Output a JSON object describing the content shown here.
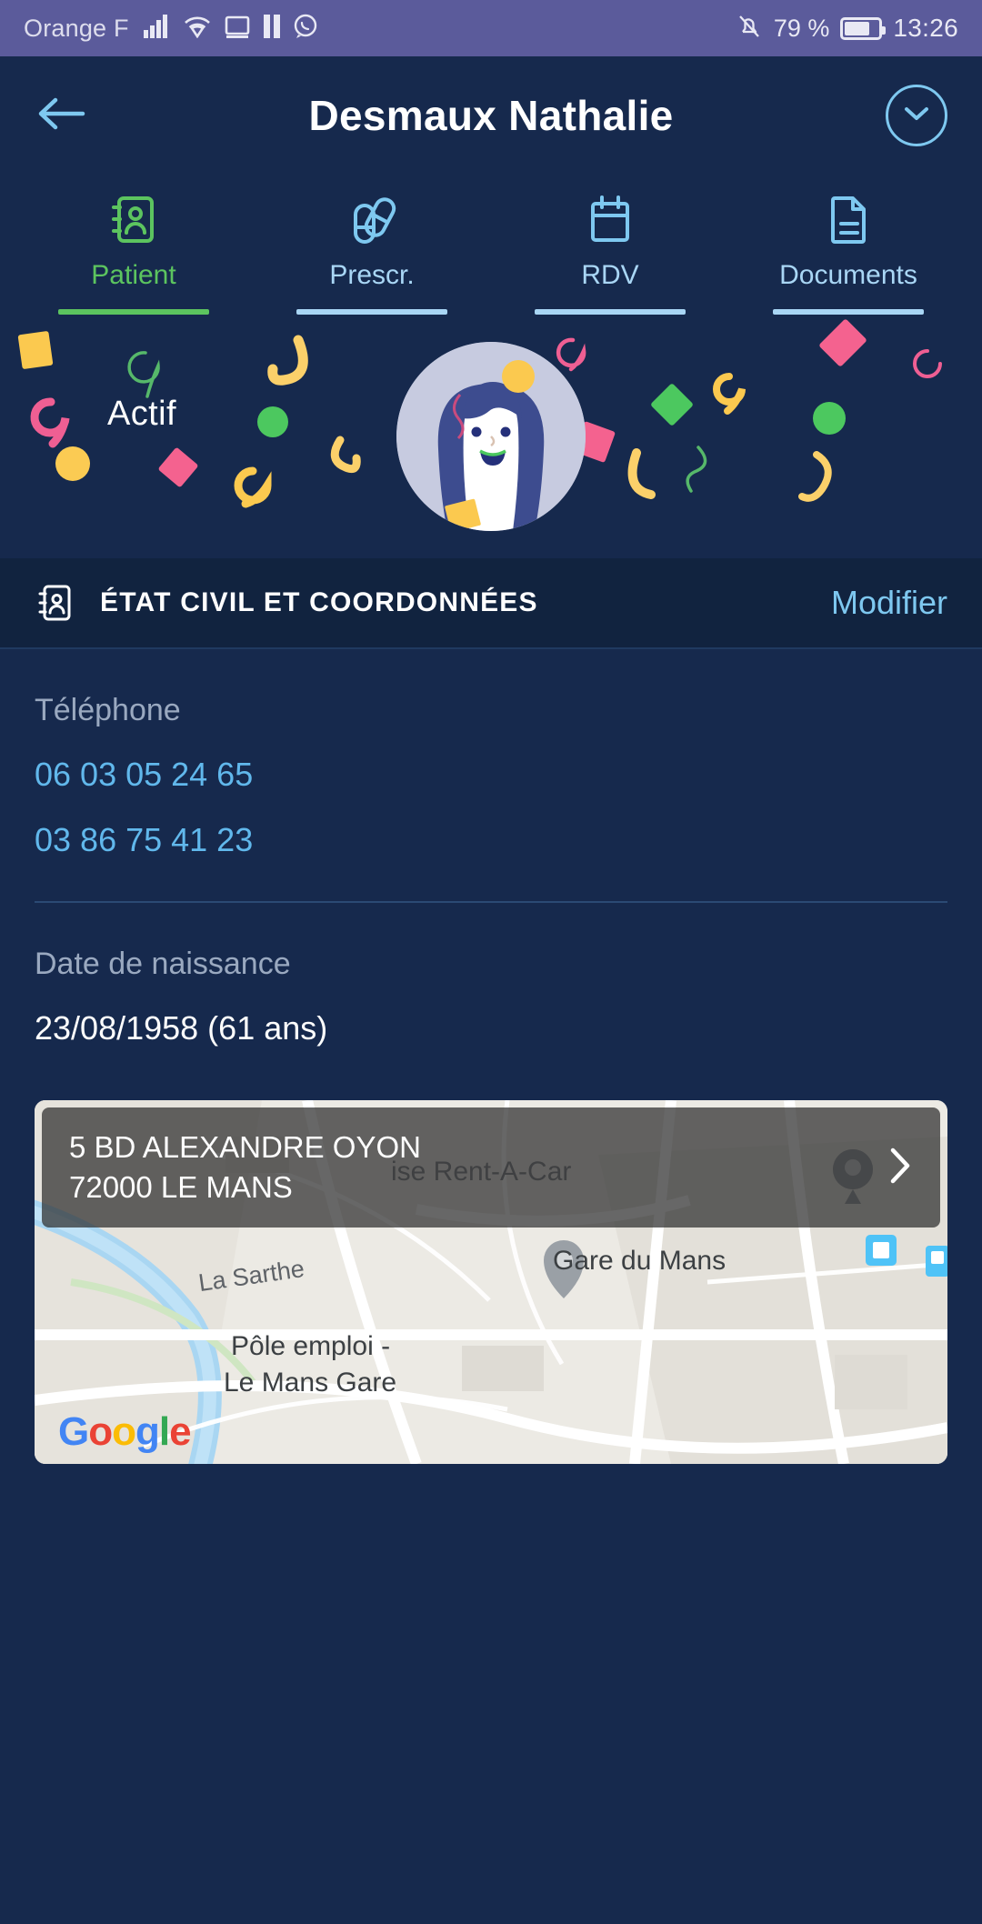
{
  "status_bar": {
    "carrier": "Orange F",
    "icons": [
      "signal-icon",
      "wifi-icon",
      "cast-icon",
      "pause-icon",
      "whatsapp-icon"
    ],
    "mute_icon": "bell-off-icon",
    "battery_percent": "79 %",
    "time": "13:26"
  },
  "app_bar": {
    "back_icon": "arrow-left-icon",
    "title": "Desmaux Nathalie",
    "expand_icon": "chevron-down-circle-icon"
  },
  "tabs": [
    {
      "label": "Patient",
      "icon": "contact-card-icon",
      "active": true
    },
    {
      "label": "Prescr.",
      "icon": "pills-icon",
      "active": false
    },
    {
      "label": "RDV",
      "icon": "calendar-icon",
      "active": false
    },
    {
      "label": "Documents",
      "icon": "document-icon",
      "active": false
    }
  ],
  "hero": {
    "status_label": "Actif",
    "avatar_alt": "patient-avatar-illustration"
  },
  "section": {
    "icon": "contact-card-icon",
    "title": "ÉTAT CIVIL ET COORDONNÉES",
    "action_label": "Modifier"
  },
  "fields": {
    "phone_label": "Téléphone",
    "phones": [
      "06 03 05 24 65",
      "03 86 75 41 23"
    ],
    "birth_label": "Date de naissance",
    "birth_value": "23/08/1958 (61 ans)"
  },
  "map_card": {
    "address_line1": "5 BD ALEXANDRE OYON",
    "address_line2": "72000 LE MANS",
    "chevron_icon": "chevron-right-icon",
    "labels": {
      "river": "La Sarthe",
      "station": "Gare du Mans",
      "poi1_line1": "Pôle emploi -",
      "poi1_line2": "Le Mans Gare",
      "rental": "ise Rent-A-Car"
    },
    "attribution": {
      "g1": "G",
      "o1": "o",
      "o2": "o",
      "g2": "g",
      "l": "l",
      "e": "e"
    }
  },
  "colors": {
    "background": "#16294d",
    "status_bar": "#5b5b9b",
    "accent_blue": "#7ec8f0",
    "accent_green": "#5cc45f",
    "link_blue": "#61b8ec"
  }
}
